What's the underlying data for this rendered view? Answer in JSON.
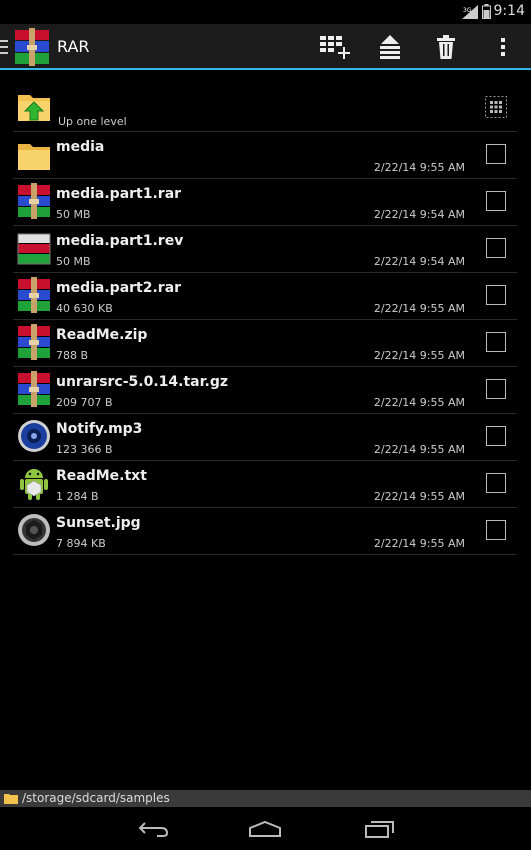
{
  "statusbar": {
    "time": "9:14",
    "network": "3G"
  },
  "actionbar": {
    "title": "RAR",
    "accent": "#33b5e5"
  },
  "up_level": {
    "label": "Up one level"
  },
  "files": [
    {
      "name": "media",
      "size": "",
      "date": "2/22/14 9:55 AM",
      "icon": "folder-icon"
    },
    {
      "name": "media.part1.rar",
      "size": "50 MB",
      "date": "2/22/14 9:54 AM",
      "icon": "rar-archive-icon"
    },
    {
      "name": "media.part1.rev",
      "size": "50 MB",
      "date": "2/22/14 9:54 AM",
      "icon": "rev-archive-icon"
    },
    {
      "name": "media.part2.rar",
      "size": "40 630 KB",
      "date": "2/22/14 9:55 AM",
      "icon": "rar-archive-icon"
    },
    {
      "name": "ReadMe.zip",
      "size": "788 B",
      "date": "2/22/14 9:55 AM",
      "icon": "rar-archive-icon"
    },
    {
      "name": "unrarsrc-5.0.14.tar.gz",
      "size": "209 707 B",
      "date": "2/22/14 9:55 AM",
      "icon": "rar-archive-icon"
    },
    {
      "name": "Notify.mp3",
      "size": "123 366 B",
      "date": "2/22/14 9:55 AM",
      "icon": "audio-file-icon"
    },
    {
      "name": "ReadMe.txt",
      "size": "1 284 B",
      "date": "2/22/14 9:55 AM",
      "icon": "android-text-icon"
    },
    {
      "name": "Sunset.jpg",
      "size": "7 894 KB",
      "date": "2/22/14 9:55 AM",
      "icon": "image-file-icon"
    }
  ],
  "pathbar": {
    "path": "/storage/sdcard/samples"
  }
}
